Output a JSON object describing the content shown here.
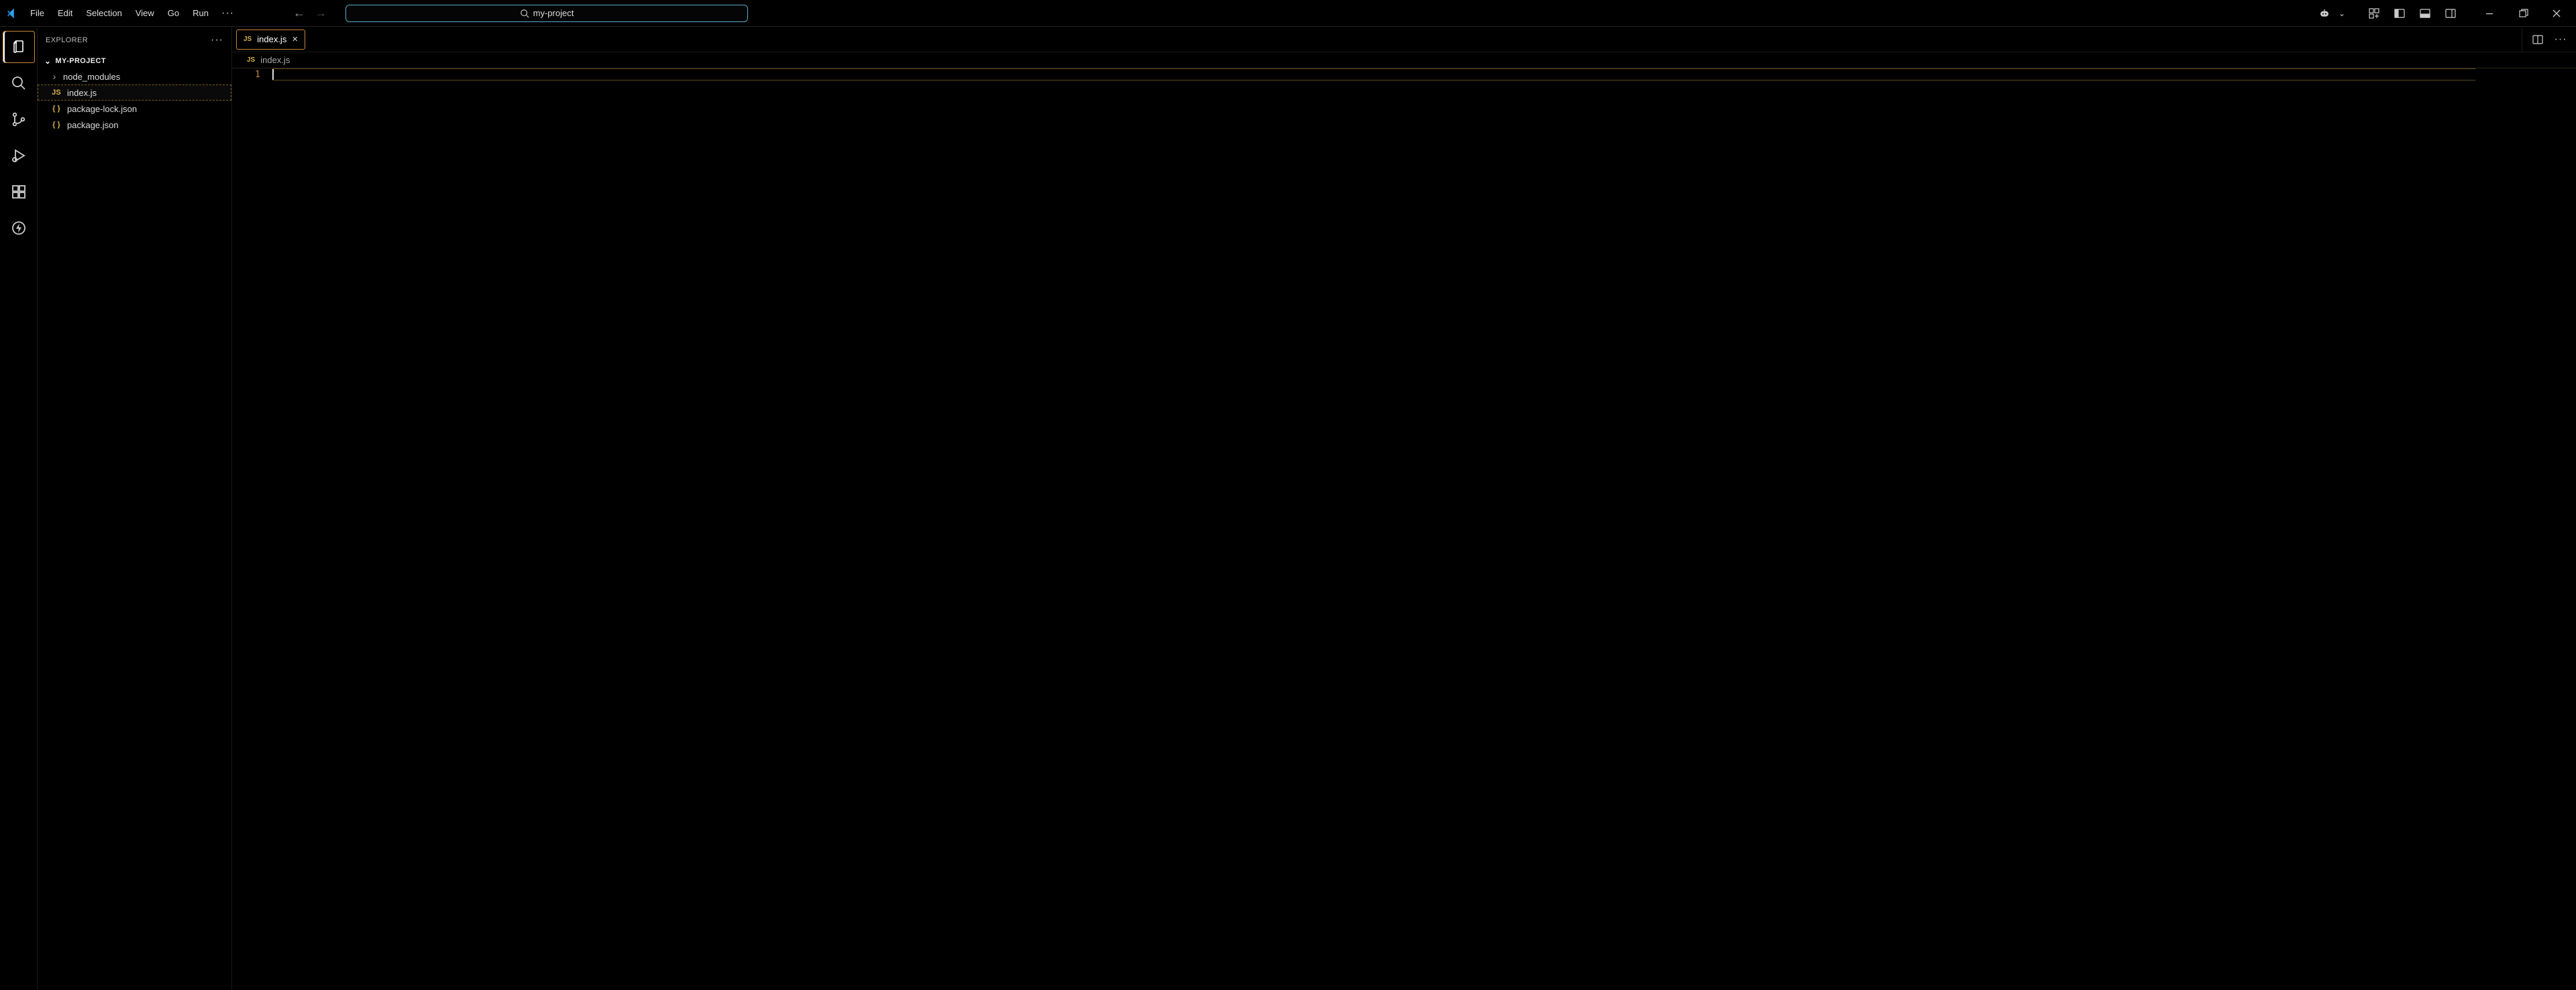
{
  "menu": {
    "items": [
      "File",
      "Edit",
      "Selection",
      "View",
      "Go",
      "Run"
    ],
    "overflow": "···"
  },
  "command_center": {
    "text": "my-project"
  },
  "sidebar": {
    "title": "EXPLORER",
    "project": "MY-PROJECT",
    "tree": [
      {
        "kind": "folder",
        "name": "node_modules"
      },
      {
        "kind": "file",
        "name": "index.js",
        "icon": "JS",
        "selected": true
      },
      {
        "kind": "file",
        "name": "package-lock.json",
        "icon": "{ }"
      },
      {
        "kind": "file",
        "name": "package.json",
        "icon": "{ }"
      }
    ]
  },
  "tabs": [
    {
      "label": "index.js",
      "icon": "JS",
      "active": true
    }
  ],
  "breadcrumb": {
    "icon": "JS",
    "text": "index.js"
  },
  "editor": {
    "line_numbers": [
      "1"
    ],
    "content": ""
  }
}
